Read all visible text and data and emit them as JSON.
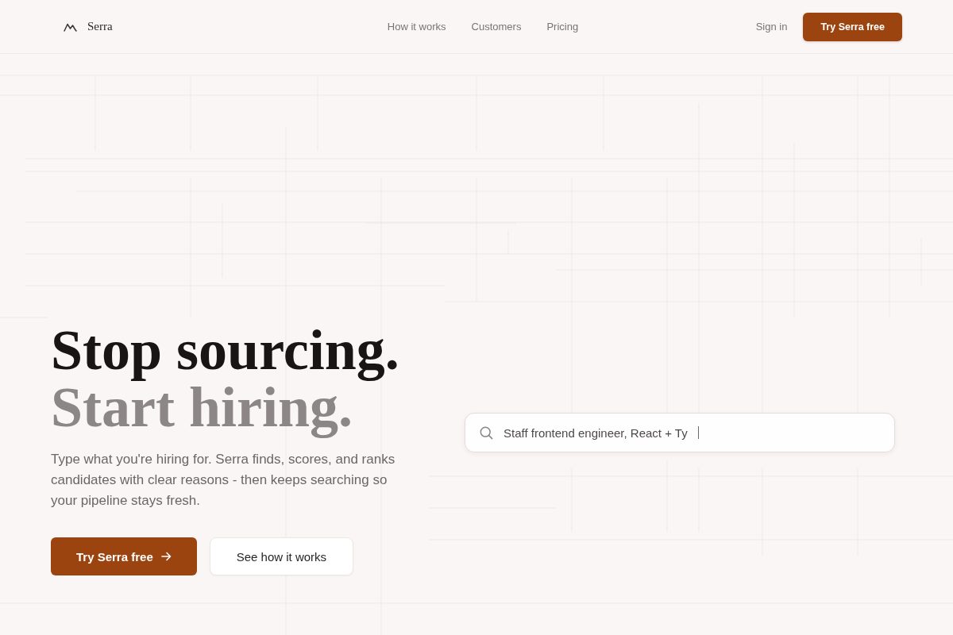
{
  "nav": {
    "brand": "Serra",
    "links": [
      "How it works",
      "Customers",
      "Pricing"
    ],
    "sign_in": "Sign in",
    "cta": "Try Serra free"
  },
  "hero": {
    "headline": {
      "first_line": "Stop sourcing.",
      "second_line": "Start hiring."
    },
    "description": "Type what you're hiring for. Serra finds, scores, and ranks candidates with clear reasons - then keeps searching so your pipeline stays fresh.",
    "buttons": [
      {
        "label": "Try Serra free",
        "kind": "primary"
      },
      {
        "label": "See how it works",
        "kind": "secondary"
      }
    ]
  },
  "search": {
    "value": "Staff frontend engineer, React + Ty",
    "focused": true
  }
}
